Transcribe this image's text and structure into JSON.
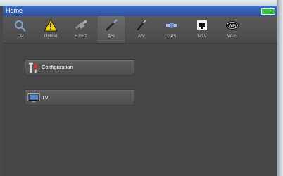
{
  "window": {
    "title": "Home"
  },
  "toolbar": {
    "tabs": [
      {
        "label": "DP",
        "icon": "dish-search-icon"
      },
      {
        "label": "Optical",
        "icon": "warning-icon"
      },
      {
        "label": "5 GHz",
        "icon": "satellite-icon"
      },
      {
        "label": "ASI",
        "icon": "cable-icon"
      },
      {
        "label": "A/V",
        "icon": "av-cable-icon"
      },
      {
        "label": "GPS",
        "icon": "gps-satellite-icon"
      },
      {
        "label": "IPTV",
        "icon": "ethernet-icon"
      },
      {
        "label": "Wi-Fi",
        "icon": "wifi-icon"
      }
    ],
    "active_tab": "ASI"
  },
  "main": {
    "items": [
      {
        "label": "Configuration",
        "icon": "tools-icon"
      },
      {
        "label": "TV",
        "icon": "tv-icon"
      }
    ]
  },
  "colors": {
    "title_bar": "#2f5aa8",
    "background": "#474747",
    "battery": "#3fbf3f",
    "warning": "#f0d000"
  }
}
